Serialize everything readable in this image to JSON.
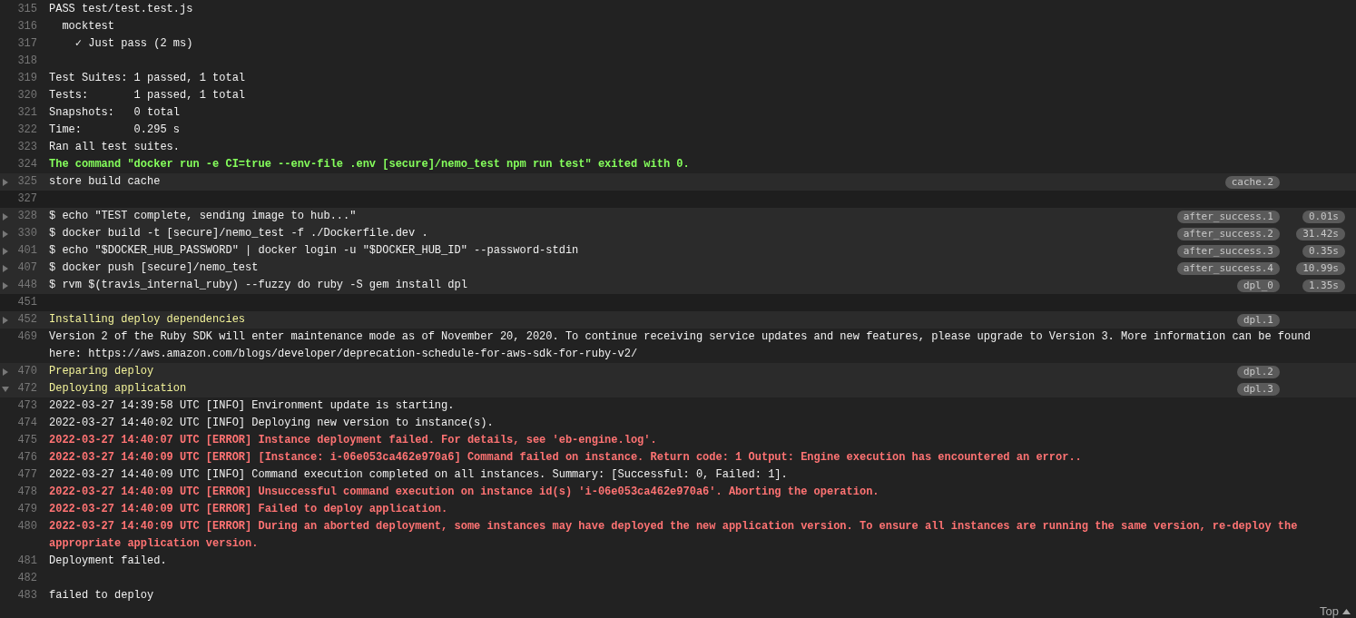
{
  "log": [
    {
      "kind": "line",
      "number": "315",
      "text": "PASS test/test.test.js"
    },
    {
      "kind": "line",
      "number": "316",
      "text": "  mocktest"
    },
    {
      "kind": "line",
      "number": "317",
      "text": "    ✓ Just pass (2 ms)"
    },
    {
      "kind": "line",
      "number": "318"
    },
    {
      "kind": "line",
      "number": "319",
      "text": "Test Suites: 1 passed, 1 total"
    },
    {
      "kind": "line",
      "number": "320",
      "text": "Tests:       1 passed, 1 total"
    },
    {
      "kind": "line",
      "number": "321",
      "text": "Snapshots:   0 total"
    },
    {
      "kind": "line",
      "number": "322",
      "text": "Time:        0.295 s"
    },
    {
      "kind": "line",
      "number": "323",
      "text": "Ran all test suites."
    },
    {
      "kind": "success",
      "number": "324",
      "text": "The command \"docker run -e CI=true --env-file .env [secure]/nemo_test npm run test\" exited with 0."
    },
    {
      "kind": "fold",
      "number": "325",
      "expanded": false,
      "text": "store build cache",
      "tag": "cache.2"
    },
    {
      "kind": "blank",
      "number": "327"
    },
    {
      "kind": "fold",
      "number": "328",
      "expanded": false,
      "text": "$ echo \"TEST complete, sending image to hub...\"",
      "tag": "after_success.1",
      "duration": "0.01s"
    },
    {
      "kind": "fold",
      "number": "330",
      "expanded": false,
      "text": "$ docker build -t [secure]/nemo_test -f ./Dockerfile.dev .",
      "tag": "after_success.2",
      "duration": "31.42s"
    },
    {
      "kind": "fold",
      "number": "401",
      "expanded": false,
      "text": "$ echo \"$DOCKER_HUB_PASSWORD\" | docker login -u \"$DOCKER_HUB_ID\" --password-stdin",
      "tag": "after_success.3",
      "duration": "0.35s"
    },
    {
      "kind": "fold",
      "number": "407",
      "expanded": false,
      "text": "$ docker push [secure]/nemo_test",
      "tag": "after_success.4",
      "duration": "10.99s"
    },
    {
      "kind": "fold",
      "number": "448",
      "expanded": false,
      "text": "$ rvm $(travis_internal_ruby) --fuzzy do ruby -S gem install dpl",
      "tag": "dpl_0",
      "duration": "1.35s"
    },
    {
      "kind": "blank",
      "number": "451"
    },
    {
      "kind": "section",
      "number": "452",
      "expanded": false,
      "text": "Installing deploy dependencies",
      "tag": "dpl.1"
    },
    {
      "kind": "line",
      "number": "469",
      "text": "Version 2 of the Ruby SDK will enter maintenance mode as of November 20, 2020. To continue receiving service updates and new features, please upgrade to Version 3. More information can be found here: https://aws.amazon.com/blogs/developer/deprecation-schedule-for-aws-sdk-for-ruby-v2/"
    },
    {
      "kind": "section",
      "number": "470",
      "expanded": false,
      "text": "Preparing deploy",
      "tag": "dpl.2"
    },
    {
      "kind": "section",
      "number": "472",
      "expanded": true,
      "text": "Deploying application",
      "tag": "dpl.3"
    },
    {
      "kind": "line",
      "number": "473",
      "text": "2022-03-27 14:39:58 UTC [INFO] Environment update is starting."
    },
    {
      "kind": "line",
      "number": "474",
      "text": "2022-03-27 14:40:02 UTC [INFO] Deploying new version to instance(s)."
    },
    {
      "kind": "error",
      "number": "475",
      "text": "2022-03-27 14:40:07 UTC [ERROR] Instance deployment failed. For details, see 'eb-engine.log'."
    },
    {
      "kind": "error",
      "number": "476",
      "text": "2022-03-27 14:40:09 UTC [ERROR] [Instance: i-06e053ca462e970a6] Command failed on instance. Return code: 1 Output: Engine execution has encountered an error.."
    },
    {
      "kind": "line",
      "number": "477",
      "text": "2022-03-27 14:40:09 UTC [INFO] Command execution completed on all instances. Summary: [Successful: 0, Failed: 1]."
    },
    {
      "kind": "error",
      "number": "478",
      "text": "2022-03-27 14:40:09 UTC [ERROR] Unsuccessful command execution on instance id(s) 'i-06e053ca462e970a6'. Aborting the operation."
    },
    {
      "kind": "error",
      "number": "479",
      "text": "2022-03-27 14:40:09 UTC [ERROR] Failed to deploy application."
    },
    {
      "kind": "error",
      "number": "480",
      "text": "2022-03-27 14:40:09 UTC [ERROR] During an aborted deployment, some instances may have deployed the new application version. To ensure all instances are running the same version, re-deploy the appropriate application version."
    },
    {
      "kind": "line",
      "number": "481",
      "text": "Deployment failed."
    },
    {
      "kind": "line",
      "number": "482"
    },
    {
      "kind": "line",
      "number": "483",
      "text": "failed to deploy"
    }
  ],
  "top_link": "Top"
}
